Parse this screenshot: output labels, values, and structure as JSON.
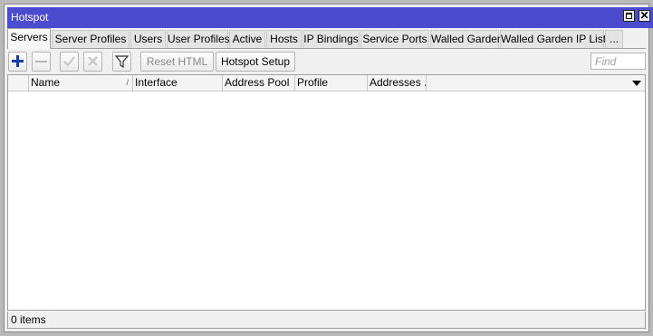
{
  "window": {
    "title": "Hotspot"
  },
  "tabs": [
    {
      "label": "Servers",
      "active": true
    },
    {
      "label": "Server Profiles"
    },
    {
      "label": "Users"
    },
    {
      "label": "User Profiles"
    },
    {
      "label": "Active"
    },
    {
      "label": "Hosts"
    },
    {
      "label": "IP Bindings"
    },
    {
      "label": "Service Ports"
    },
    {
      "label": "Walled Garden"
    },
    {
      "label": "Walled Garden IP List"
    },
    {
      "label": "..."
    }
  ],
  "toolbar": {
    "add_icon": "plus-icon",
    "remove_icon": "minus-icon",
    "enable_icon": "check-icon",
    "disable_icon": "x-icon",
    "filter_icon": "funnel-icon",
    "reset_html_label": "Reset HTML",
    "hotspot_setup_label": "Hotspot Setup",
    "find_placeholder": "Find"
  },
  "table": {
    "columns": [
      "Name",
      "Interface",
      "Address Pool",
      "Profile",
      "Addresses ..."
    ],
    "sort_marker": "/",
    "rows": []
  },
  "status": {
    "items_text": "0 items"
  },
  "colors": {
    "titlebar": "#4b4bd0",
    "add_icon": "#1a3aa8"
  }
}
